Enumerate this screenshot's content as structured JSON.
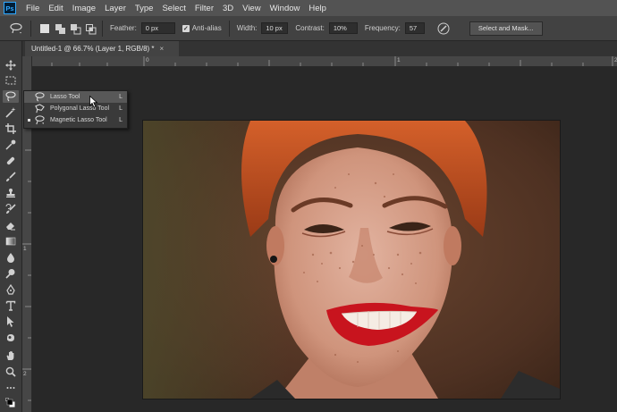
{
  "menubar": {
    "logo": "Ps",
    "items": [
      "File",
      "Edit",
      "Image",
      "Layer",
      "Type",
      "Select",
      "Filter",
      "3D",
      "View",
      "Window",
      "Help"
    ]
  },
  "options": {
    "feather_label": "Feather:",
    "feather_value": "0 px",
    "antialias_label": "Anti-alias",
    "width_label": "Width:",
    "width_value": "10 px",
    "contrast_label": "Contrast:",
    "contrast_value": "10%",
    "frequency_label": "Frequency:",
    "frequency_value": "57",
    "select_mask_label": "Select and Mask..."
  },
  "document": {
    "tab_title": "Untitled-1 @ 66.7% (Layer 1, RGB/8) *",
    "close_glyph": "×"
  },
  "ruler": {
    "top_ticks": [
      "0",
      "1",
      "2"
    ],
    "left_ticks": [
      "1",
      "2"
    ]
  },
  "flyout": {
    "items": [
      {
        "label": "Lasso Tool",
        "key": "L"
      },
      {
        "label": "Polygonal Lasso Tool",
        "key": "L"
      },
      {
        "label": "Magnetic Lasso Tool",
        "key": "L"
      }
    ]
  },
  "tools": [
    "move-icon",
    "marquee-icon",
    "lasso-icon",
    "magic-wand-icon",
    "crop-icon",
    "eyedropper-icon",
    "healing-brush-icon",
    "brush-icon",
    "clone-stamp-icon",
    "history-brush-icon",
    "eraser-icon",
    "gradient-icon",
    "blur-icon",
    "dodge-icon",
    "pen-icon",
    "type-icon",
    "path-selection-icon",
    "shape-icon",
    "hand-icon",
    "zoom-icon",
    "more-tools-icon",
    "color-swatches-icon"
  ],
  "colors": {
    "lipstick": "#c8141e",
    "hair": "#c0501c",
    "skin": "#d9a088",
    "background_photo": "#5a3a28",
    "accent": "#31a8ff"
  }
}
